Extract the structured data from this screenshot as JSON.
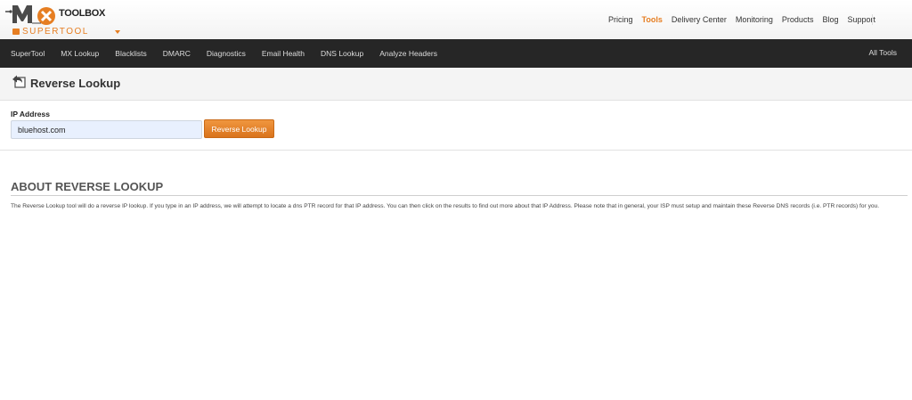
{
  "header": {
    "logo_word": "TOOLBOX",
    "logo_sub": "SUPERTOOL",
    "nav": [
      {
        "label": "Pricing"
      },
      {
        "label": "Tools"
      },
      {
        "label": "Delivery Center"
      },
      {
        "label": "Monitoring"
      },
      {
        "label": "Products"
      },
      {
        "label": "Blog"
      },
      {
        "label": "Support"
      }
    ],
    "active_nav": "Tools",
    "accent_color": "#e67e22"
  },
  "toolbar": {
    "items": [
      {
        "label": "SuperTool"
      },
      {
        "label": "MX Lookup"
      },
      {
        "label": "Blacklists"
      },
      {
        "label": "DMARC"
      },
      {
        "label": "Diagnostics"
      },
      {
        "label": "Email Health"
      },
      {
        "label": "DNS Lookup"
      },
      {
        "label": "Analyze Headers"
      }
    ],
    "all_tools": "All Tools"
  },
  "page": {
    "title": "Reverse Lookup",
    "title_icon": "reverse-arrow-icon"
  },
  "form": {
    "label": "IP Address",
    "input_value": "bluehost.com",
    "button_label": "Reverse Lookup"
  },
  "about": {
    "title": "ABOUT REVERSE LOOKUP",
    "text": "The Reverse Lookup tool will do a reverse IP lookup. If you type in an IP address, we will attempt to locate a dns PTR record for that IP address. You can then click on the results to find out more about that IP Address. Please note that in general, your ISP must setup and maintain these Reverse DNS records (i.e. PTR records) for you."
  }
}
